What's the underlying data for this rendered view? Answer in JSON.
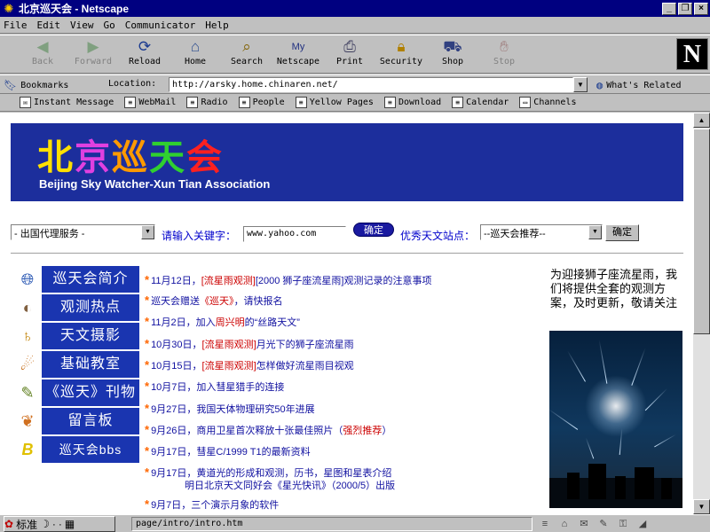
{
  "window": {
    "title": "北京巡天会 - Netscape",
    "controls": [
      "_",
      "❐",
      "×"
    ]
  },
  "menubar": [
    "File",
    "Edit",
    "View",
    "Go",
    "Communicator",
    "Help"
  ],
  "toolbar": {
    "buttons": [
      {
        "label": "Back",
        "icon": "back-arrow-icon",
        "enabled": false
      },
      {
        "label": "Forward",
        "icon": "forward-arrow-icon",
        "enabled": false
      },
      {
        "label": "Reload",
        "icon": "reload-icon",
        "enabled": true
      },
      {
        "label": "Home",
        "icon": "home-icon",
        "enabled": true
      },
      {
        "label": "Search",
        "icon": "search-icon",
        "enabled": true
      },
      {
        "label": "Netscape",
        "icon": "netscape-icon",
        "enabled": true
      },
      {
        "label": "Print",
        "icon": "print-icon",
        "enabled": true
      },
      {
        "label": "Security",
        "icon": "lock-icon",
        "enabled": true
      },
      {
        "label": "Shop",
        "icon": "shop-icon",
        "enabled": true
      },
      {
        "label": "Stop",
        "icon": "stop-icon",
        "enabled": false
      }
    ],
    "logo": "N"
  },
  "location": {
    "bookmarks_label": "Bookmarks",
    "location_label": "Location:",
    "url": "http://arsky.home.chinaren.net/",
    "related_label": "What's Related"
  },
  "personal_toolbar": [
    "Instant Message",
    "WebMail",
    "Radio",
    "People",
    "Yellow Pages",
    "Download",
    "Calendar",
    "Channels"
  ],
  "page": {
    "banner": {
      "logo_chars": [
        {
          "char": "北",
          "color": "#ffe000"
        },
        {
          "char": "京",
          "color": "#e040e0"
        },
        {
          "char": "巡",
          "color": "#ff9a00"
        },
        {
          "char": "天",
          "color": "#30d030"
        },
        {
          "char": "会",
          "color": "#ff2020"
        }
      ],
      "subtitle": "Beijing Sky Watcher-Xun Tian Association",
      "bg_color": "#1c2e9c"
    },
    "search": {
      "service_select": "- 出国代理服务 -",
      "keyword_label": "请输入关键字：",
      "keyword_value": "www.yahoo.com",
      "submit_label": "确定",
      "sites_label": "优秀天文站点：",
      "sites_select": "--巡天会推荐--",
      "sites_submit": "确定"
    },
    "menu": [
      {
        "label": "巡天会简介",
        "icon": "globe-icon"
      },
      {
        "label": "观测热点",
        "icon": "moon-icon"
      },
      {
        "label": "天文摄影",
        "icon": "saturn-icon"
      },
      {
        "label": "基础教室",
        "icon": "comet-icon"
      },
      {
        "label": "《巡天》刊物",
        "icon": "book-icon"
      },
      {
        "label": "留言板",
        "icon": "leaf-icon"
      },
      {
        "label": "巡天会bbs",
        "icon": "letter-b-icon"
      }
    ],
    "news": [
      {
        "pre": "11月12日，",
        "red": "[流星雨观测]",
        "post": "[2000 狮子座流星雨]观测记录的注意事项"
      },
      {
        "pre": "巡天会赠送",
        "red": "《巡天》",
        "post": "，请快报名"
      },
      {
        "pre": "11月2日，加入",
        "red": "周兴明",
        "post": "的“丝路天文”"
      },
      {
        "pre": "10月30日，",
        "red": "[流星雨观测]",
        "post": "月光下的狮子座流星雨"
      },
      {
        "pre": "10月15日，",
        "red": "[流星雨观测]",
        "post": "怎样做好流星雨目视观"
      },
      {
        "pre": "10月7日，加入彗星猎手的连接",
        "red": "",
        "post": ""
      },
      {
        "pre": "9月27日，我国天体物理研究50年进展",
        "red": "",
        "post": ""
      },
      {
        "pre": "9月26日，商用卫星首次释放十张最佳照片（",
        "red": "强烈推荐",
        "post": "）"
      },
      {
        "pre": "9月17日，彗星C/1999 T1的最新资料",
        "red": "",
        "post": ""
      },
      {
        "pre": "9月17日，黄道光的形成和观测，历书，星图和星表介绍",
        "red": "",
        "post": ""
      },
      {
        "pre": "明日北京天文同好会《星光快讯》（2000/5）出版",
        "red": "",
        "post": ""
      },
      {
        "pre": "9月7日，三个演示月象的软件",
        "red": "",
        "post": ""
      }
    ],
    "side_text": "为迎接狮子座流星雨，我们将提供全套的观测方案，及时更新，敬请关注"
  },
  "status": {
    "ime": [
      "标准",
      "☽",
      "·",
      "·",
      "▦"
    ],
    "text": "page/intro/intro.htm"
  }
}
